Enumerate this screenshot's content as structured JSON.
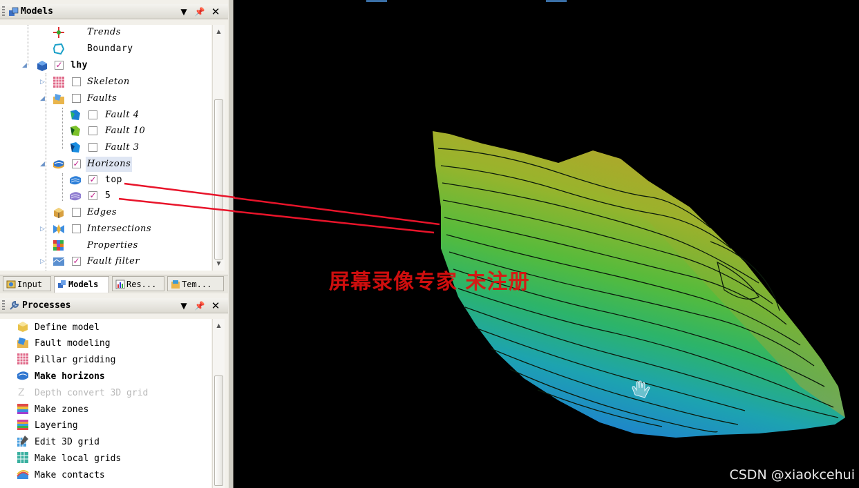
{
  "models_panel": {
    "title": "Models",
    "tree": [
      {
        "label": "Trends",
        "icon": "trends-icon",
        "checkbox": "none"
      },
      {
        "label": "Boundary",
        "icon": "boundary-icon",
        "checkbox": "none"
      },
      {
        "label": "lhy",
        "icon": "model-cube-icon",
        "checkbox": "checked"
      },
      {
        "label": "Skeleton",
        "icon": "skeleton-grid-icon",
        "checkbox": "unchecked"
      },
      {
        "label": "Faults",
        "icon": "faults-folder-icon",
        "checkbox": "unchecked"
      },
      {
        "label": "Fault 4",
        "icon": "fault-icon",
        "checkbox": "unchecked"
      },
      {
        "label": "Fault 10",
        "icon": "fault-icon",
        "checkbox": "unchecked"
      },
      {
        "label": "Fault 3",
        "icon": "fault-icon",
        "checkbox": "unchecked"
      },
      {
        "label": "Horizons",
        "icon": "horizons-folder-icon",
        "checkbox": "checked"
      },
      {
        "label": "top",
        "icon": "horizon-icon",
        "checkbox": "checked"
      },
      {
        "label": "5",
        "icon": "horizon-icon",
        "checkbox": "checked"
      },
      {
        "label": "Edges",
        "icon": "edges-icon",
        "checkbox": "unchecked"
      },
      {
        "label": "Intersections",
        "icon": "intersections-icon",
        "checkbox": "unchecked"
      },
      {
        "label": "Properties",
        "icon": "properties-icon",
        "checkbox": "none"
      },
      {
        "label": "Fault filter",
        "icon": "fault-filter-icon",
        "checkbox": "checked"
      }
    ]
  },
  "tabs": [
    {
      "label": "Input",
      "icon": "input-tab-icon"
    },
    {
      "label": "Models",
      "icon": "models-tab-icon"
    },
    {
      "label": "Res...",
      "icon": "results-tab-icon"
    },
    {
      "label": "Tem...",
      "icon": "templates-tab-icon"
    }
  ],
  "processes_panel": {
    "title": "Processes",
    "items": [
      {
        "label": "Define model",
        "icon": "define-model-icon",
        "state": "normal"
      },
      {
        "label": "Fault modeling",
        "icon": "fault-modeling-icon",
        "state": "normal"
      },
      {
        "label": "Pillar gridding",
        "icon": "pillar-gridding-icon",
        "state": "normal"
      },
      {
        "label": "Make horizons",
        "icon": "make-horizons-icon",
        "state": "active"
      },
      {
        "label": "Depth convert 3D grid",
        "icon": "depth-convert-icon",
        "state": "disabled"
      },
      {
        "label": "Make zones",
        "icon": "make-zones-icon",
        "state": "normal"
      },
      {
        "label": "Layering",
        "icon": "layering-icon",
        "state": "normal"
      },
      {
        "label": "Edit 3D grid",
        "icon": "edit-3d-grid-icon",
        "state": "normal"
      },
      {
        "label": "Make local grids",
        "icon": "make-local-grids-icon",
        "state": "normal"
      },
      {
        "label": "Make contacts",
        "icon": "make-contacts-icon",
        "state": "normal"
      }
    ]
  },
  "viewport": {
    "watermark": "屏幕录像专家 未注册",
    "credit": "CSDN @xiaokcehui"
  },
  "colors": {
    "checkmark": "#c0208a",
    "annotation_line": "#e8142a",
    "surface_high": "#b5a62a",
    "surface_mid": "#38b84a",
    "surface_low": "#1e8fd0"
  }
}
